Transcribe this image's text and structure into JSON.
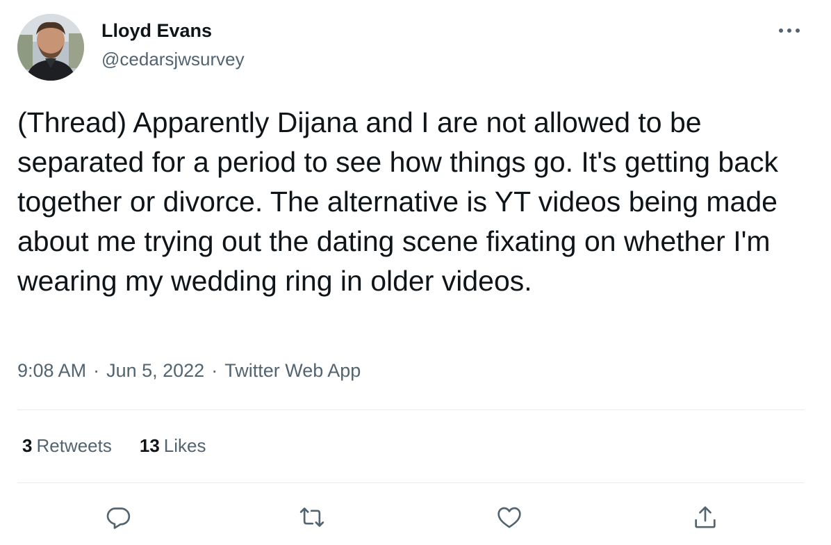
{
  "author": {
    "name": "Lloyd Evans",
    "handle": "@cedarsjwsurvey"
  },
  "tweet": {
    "text": "(Thread) Apparently Dijana and I are not allowed to be separated for a period to see how things go. It's getting back together or divorce. The alternative is YT videos being made about me trying out the dating scene fixating on whether I'm wearing my wedding ring in older videos.",
    "time": "9:08 AM",
    "date": "Jun 5, 2022",
    "source": "Twitter Web App",
    "separator": "·"
  },
  "stats": {
    "retweets_count": "3",
    "retweets_label": "Retweets",
    "likes_count": "13",
    "likes_label": "Likes"
  },
  "icons": {
    "more": "more-horizontal-icon",
    "reply": "reply-icon",
    "retweet": "retweet-icon",
    "like": "heart-icon",
    "share": "share-icon"
  },
  "colors": {
    "text": "#0f1419",
    "secondary_text": "#536471",
    "icon": "#536471",
    "divider": "#e6ecf0"
  }
}
